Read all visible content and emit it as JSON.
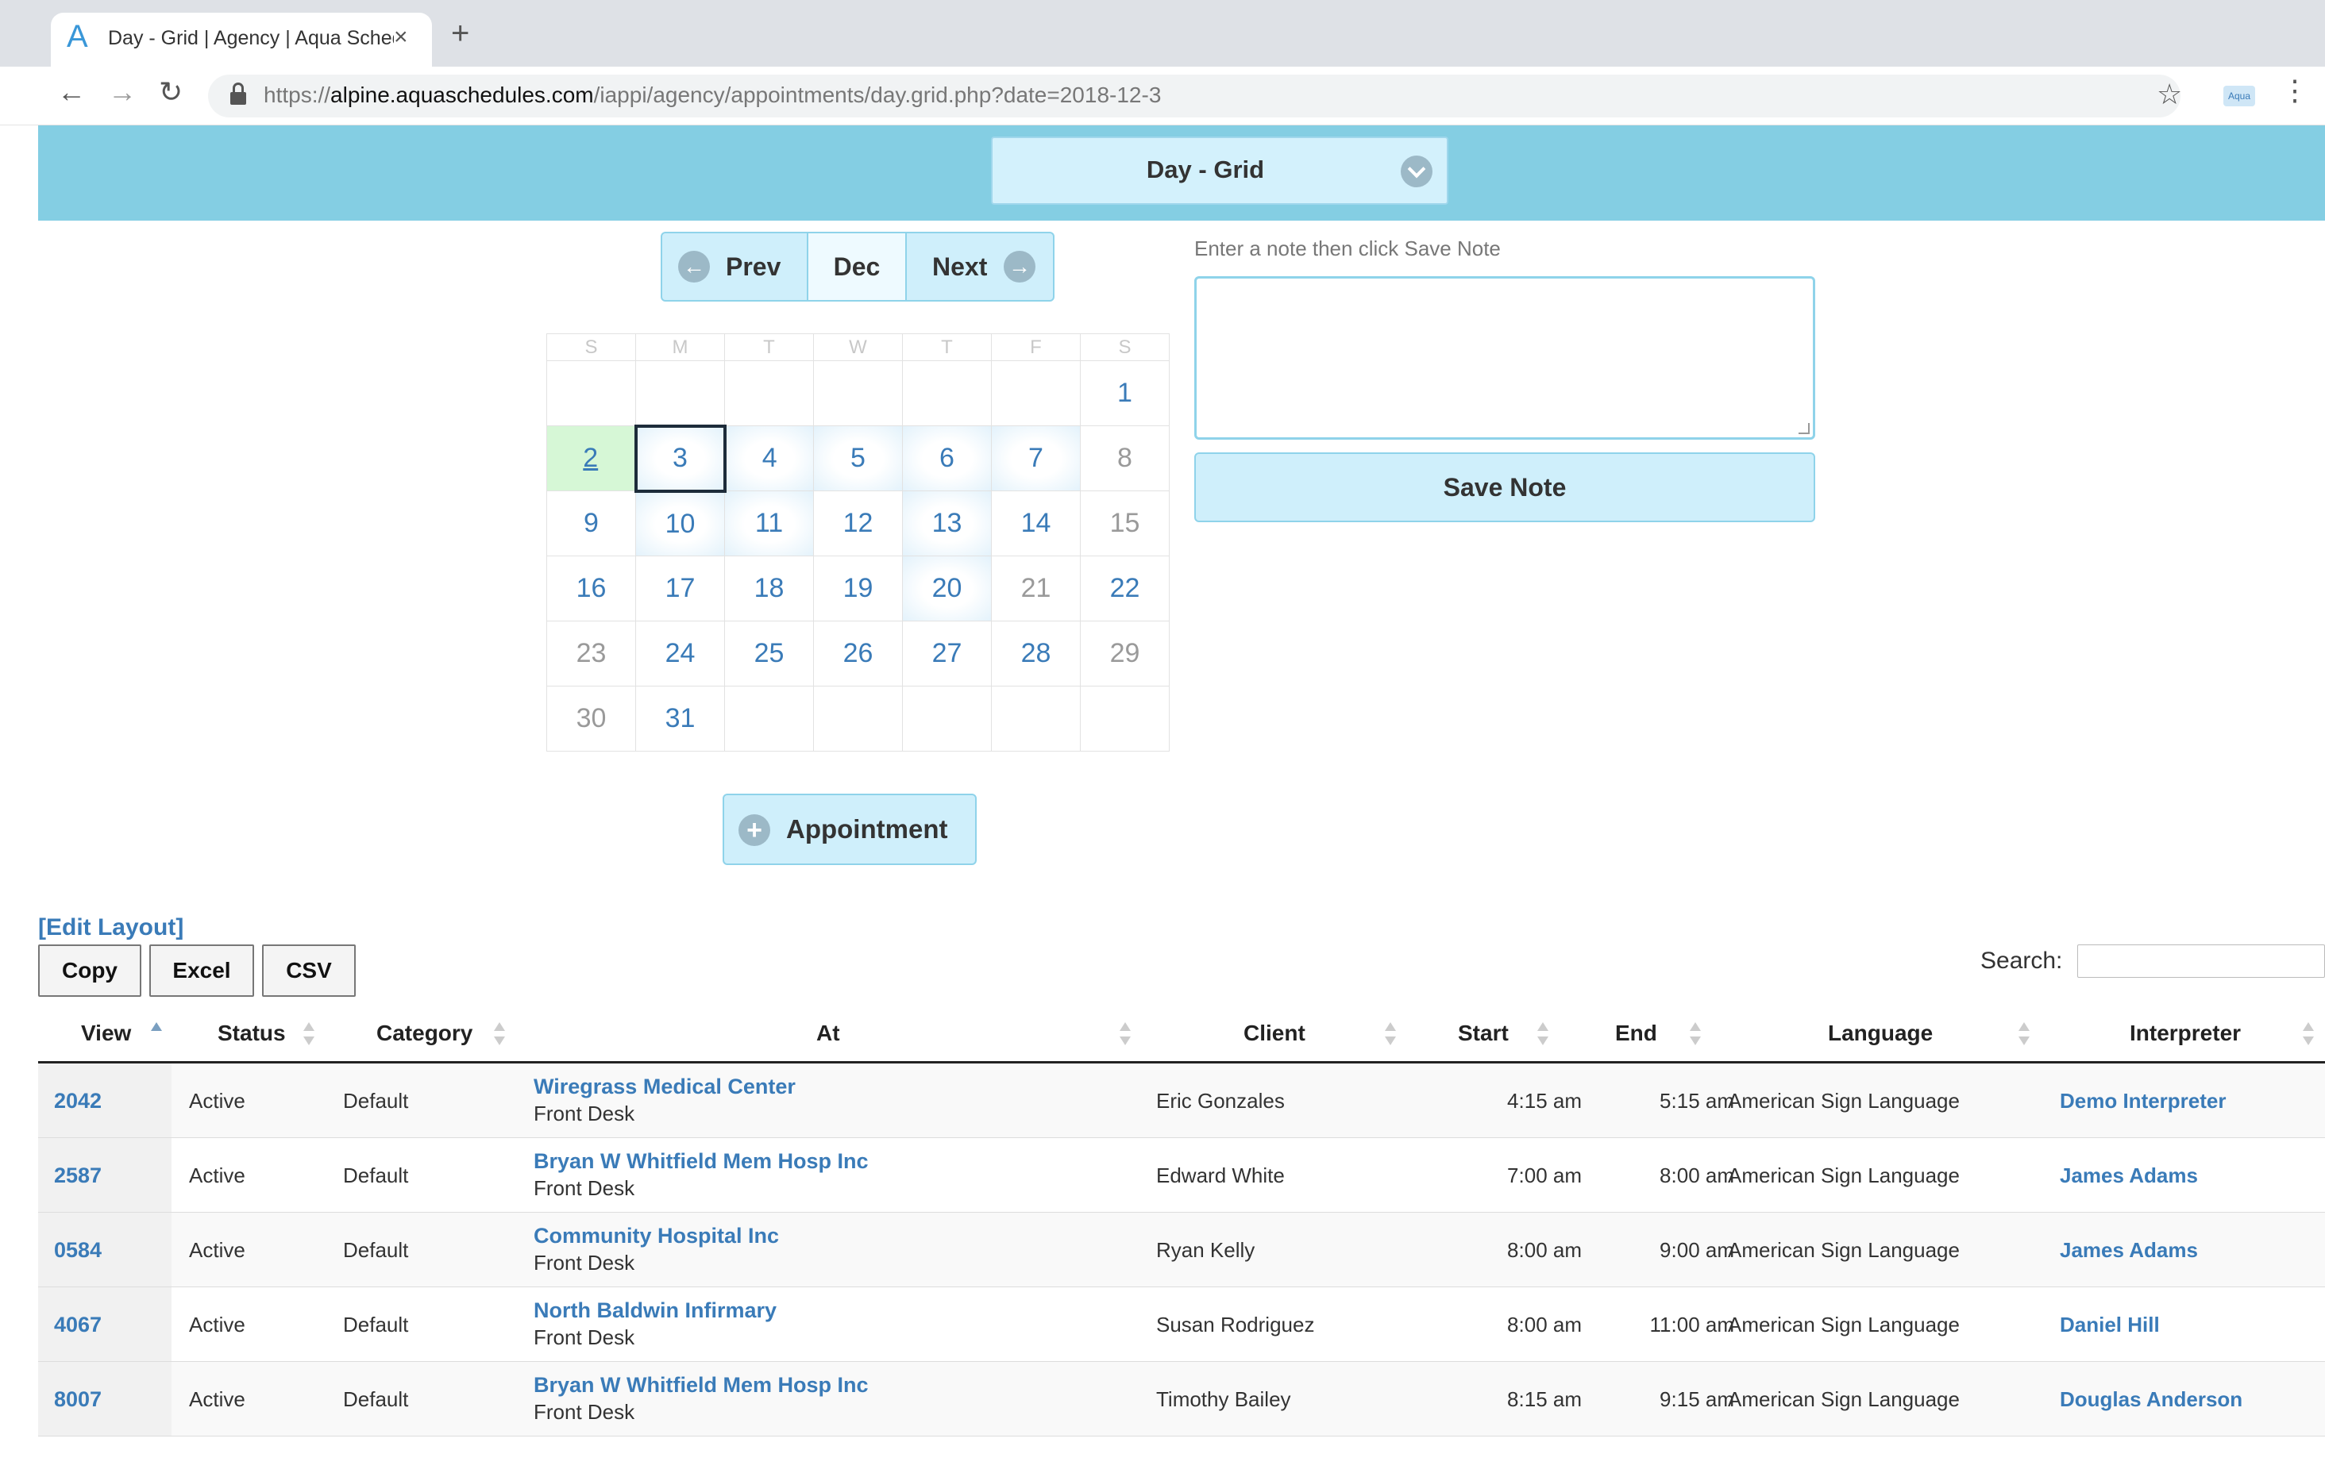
{
  "browser": {
    "tab_title": "Day - Grid | Agency | Aqua Schedules",
    "tab_logo": "A",
    "tab_close": "×",
    "new_tab": "+",
    "url_scheme": "https://",
    "url_host": "alpine.aquaschedules.com",
    "url_path": "/iappi/agency/appointments/day.grid.php?date=2018-12-3",
    "back": "←",
    "forward": "→",
    "reload": "↻",
    "star": "☆",
    "extension": "Aqua",
    "menu": "⋮"
  },
  "header": {
    "view_select": "Day - Grid"
  },
  "month_nav": {
    "prev": "Prev",
    "month": "Dec",
    "next": "Next",
    "prev_icon": "arrow-left-circle-icon",
    "next_icon": "arrow-right-circle-icon"
  },
  "calendar": {
    "weekdays": [
      "S",
      "M",
      "T",
      "W",
      "T",
      "F",
      "S"
    ],
    "weeks": [
      [
        "",
        "",
        "",
        "",
        "",
        "",
        "1"
      ],
      [
        "2",
        "3",
        "4",
        "5",
        "6",
        "7",
        "8"
      ],
      [
        "9",
        "10",
        "11",
        "12",
        "13",
        "14",
        "15"
      ],
      [
        "16",
        "17",
        "18",
        "19",
        "20",
        "21",
        "22"
      ],
      [
        "23",
        "24",
        "25",
        "26",
        "27",
        "28",
        "29"
      ],
      [
        "30",
        "31",
        "",
        "",
        "",
        "",
        ""
      ]
    ],
    "today": "2",
    "selected": "3"
  },
  "note": {
    "label": "Enter a note then click Save Note",
    "value": "",
    "save_label": "Save Note"
  },
  "appointment_button": {
    "label": "Appointment",
    "icon": "+"
  },
  "table_tools": {
    "edit_layout": "[Edit Layout]",
    "copy": "Copy",
    "excel": "Excel",
    "csv": "CSV",
    "search_label": "Search:",
    "search_value": ""
  },
  "table": {
    "columns": [
      "View",
      "Status",
      "Category",
      "At",
      "Client",
      "Start",
      "End",
      "Language",
      "Interpreter"
    ],
    "rows": [
      {
        "view": "2042",
        "status": "Active",
        "category": "Default",
        "at": "Wiregrass Medical Center",
        "at_sub": "Front Desk",
        "client": "Eric Gonzales",
        "start": "4:15 am",
        "end": "5:15 am",
        "language": "American Sign Language",
        "interpreter": "Demo Interpreter"
      },
      {
        "view": "2587",
        "status": "Active",
        "category": "Default",
        "at": "Bryan W Whitfield Mem Hosp Inc",
        "at_sub": "Front Desk",
        "client": "Edward White",
        "start": "7:00 am",
        "end": "8:00 am",
        "language": "American Sign Language",
        "interpreter": "James Adams"
      },
      {
        "view": "0584",
        "status": "Active",
        "category": "Default",
        "at": "Community Hospital Inc",
        "at_sub": "Front Desk",
        "client": "Ryan Kelly",
        "start": "8:00 am",
        "end": "9:00 am",
        "language": "American Sign Language",
        "interpreter": "James Adams"
      },
      {
        "view": "4067",
        "status": "Active",
        "category": "Default",
        "at": "North Baldwin Infirmary",
        "at_sub": "Front Desk",
        "client": "Susan Rodriguez",
        "start": "8:00 am",
        "end": "11:00 am",
        "language": "American Sign Language",
        "interpreter": "Daniel Hill"
      },
      {
        "view": "8007",
        "status": "Active",
        "category": "Default",
        "at": "Bryan W Whitfield Mem Hosp Inc",
        "at_sub": "Front Desk",
        "client": "Timothy Bailey",
        "start": "8:15 am",
        "end": "9:15 am",
        "language": "American Sign Language",
        "interpreter": "Douglas Anderson"
      }
    ]
  }
}
